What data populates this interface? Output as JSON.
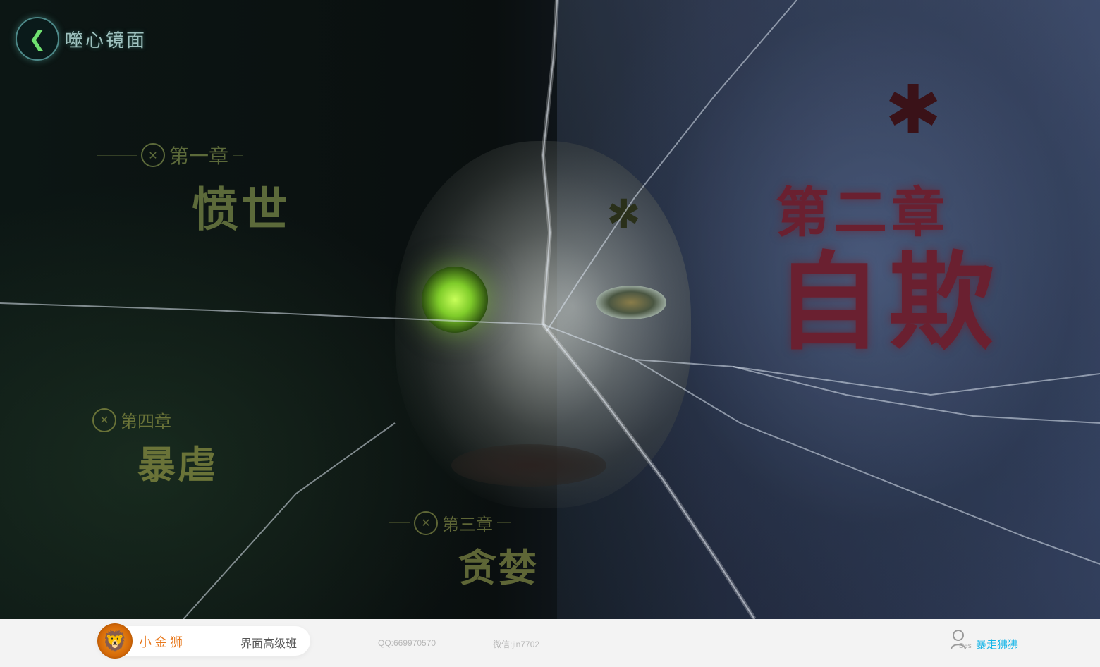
{
  "header": {
    "back_icon": "chevron-left-icon",
    "title": "噬心镜面"
  },
  "chapters": [
    {
      "label": "第一章",
      "name": "愤世",
      "icon": "x-emblem-icon"
    },
    {
      "label": "第二章",
      "name": "自欺"
    },
    {
      "label": "第三章",
      "name": "贪婪",
      "icon": "x-emblem-icon"
    },
    {
      "label": "第四章",
      "name": "暴虐",
      "icon": "x-emblem-icon"
    }
  ],
  "footer": {
    "brand_name": "小金狮",
    "course": "界面高级班",
    "qq": "QQ:669970570",
    "wechat": "微信:jin7702",
    "tag": "Des",
    "author": "暴走狒狒",
    "avatar_icon": "lion-logo-icon",
    "user_icon": "user-icon"
  },
  "colors": {
    "chapter_green": "#5c6a3a",
    "chapter_red": "#6a2030",
    "brand_orange": "#e8781c",
    "author_blue": "#17b6e8"
  }
}
